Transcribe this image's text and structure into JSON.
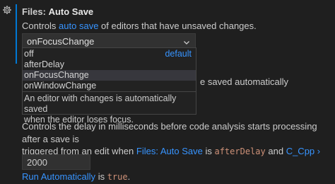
{
  "auto_save": {
    "title_category": "Files:",
    "title_name": "Auto Save",
    "desc_pre": "Controls",
    "desc_link": "auto save",
    "desc_post": "of editors that have unsaved changes.",
    "selected_value": "onFocusChange",
    "options": [
      {
        "label": "off",
        "badge": "default"
      },
      {
        "label": "afterDelay"
      },
      {
        "label": "onFocusChange",
        "selected": true
      },
      {
        "label": "onWindowChange"
      }
    ],
    "option_description_line1": "An editor with changes is automatically saved",
    "option_description_line2": "when the editor loses focus.",
    "behind_text": "e saved automatically"
  },
  "code_analysis_delay": {
    "desc_line1": "Controls the delay in milliseconds before code analysis starts processing after a save is",
    "desc_line2_pre": "triggered from an edit when",
    "link1": "Files: Auto Save",
    "is1": "is",
    "code1": "afterDelay",
    "and": "and",
    "link2": "C_Cpp › Code Analysis:",
    "link2_cont": "Run Automatically",
    "is2": "is",
    "code2": "true",
    "end": ".",
    "value": "2000"
  },
  "icons": {
    "gear": "gear-icon",
    "chevron": "chevron-down-icon"
  },
  "colors": {
    "background": "#1f1f1f",
    "accent": "#0078d4",
    "link": "#3794ff",
    "code": "#ce9178"
  }
}
